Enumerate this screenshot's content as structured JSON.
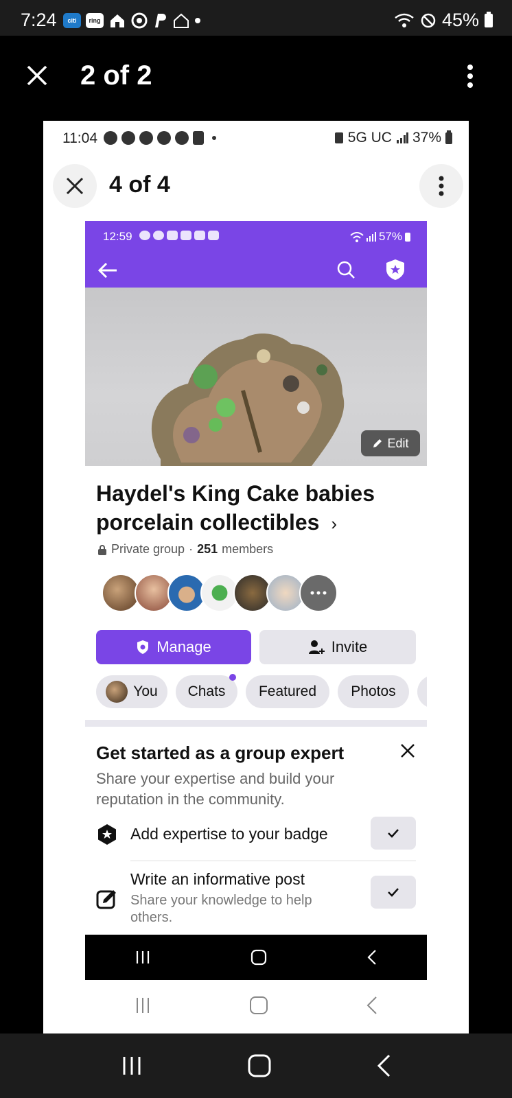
{
  "outer_status": {
    "time": "7:24",
    "battery": "45%",
    "app_icons": [
      "citi",
      "ring"
    ]
  },
  "viewer": {
    "title": "2 of 2"
  },
  "mid_status": {
    "time": "11:04",
    "network": "5G UC",
    "battery": "37%"
  },
  "mid_viewer": {
    "title": "4 of 4"
  },
  "inner_status": {
    "time": "12:59",
    "battery": "57%"
  },
  "group": {
    "edit_label": "Edit",
    "title": "Haydel's King Cake babies porcelain collectibles",
    "title_chevron": "›",
    "privacy": "Private group",
    "separator": "·",
    "member_count": "251",
    "members_label": "members",
    "manage_label": "Manage",
    "invite_label": "Invite"
  },
  "tabs": [
    {
      "label": "You"
    },
    {
      "label": "Chats"
    },
    {
      "label": "Featured"
    },
    {
      "label": "Photos"
    }
  ],
  "expert_card": {
    "title": "Get started as a group expert",
    "subtitle": "Share your expertise and build your reputation in the community.",
    "tasks": [
      {
        "label": "Add expertise to your badge",
        "sub": ""
      },
      {
        "label": "Write an informative post",
        "sub": "Share your knowledge to help others."
      }
    ]
  },
  "colors": {
    "accent": "#7a45e6",
    "chip_bg": "#e6e5eb"
  }
}
